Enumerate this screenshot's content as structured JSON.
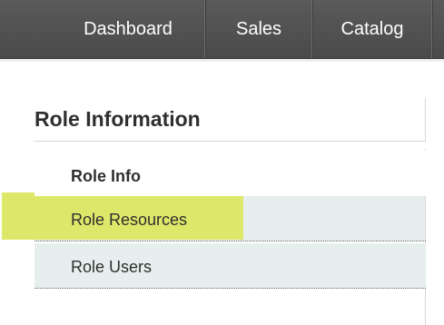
{
  "nav": {
    "items": [
      {
        "label": "Dashboard"
      },
      {
        "label": "Sales"
      },
      {
        "label": "Catalog"
      }
    ]
  },
  "panel": {
    "title": "Role Information",
    "tabs": [
      {
        "label": "Role Info",
        "active": true
      },
      {
        "label": "Role Resources",
        "highlighted": true
      },
      {
        "label": "Role Users"
      }
    ]
  },
  "colors": {
    "nav_background": "#4f4f4f",
    "tab_background": "#e6eeee",
    "highlight": "#dde86a"
  }
}
